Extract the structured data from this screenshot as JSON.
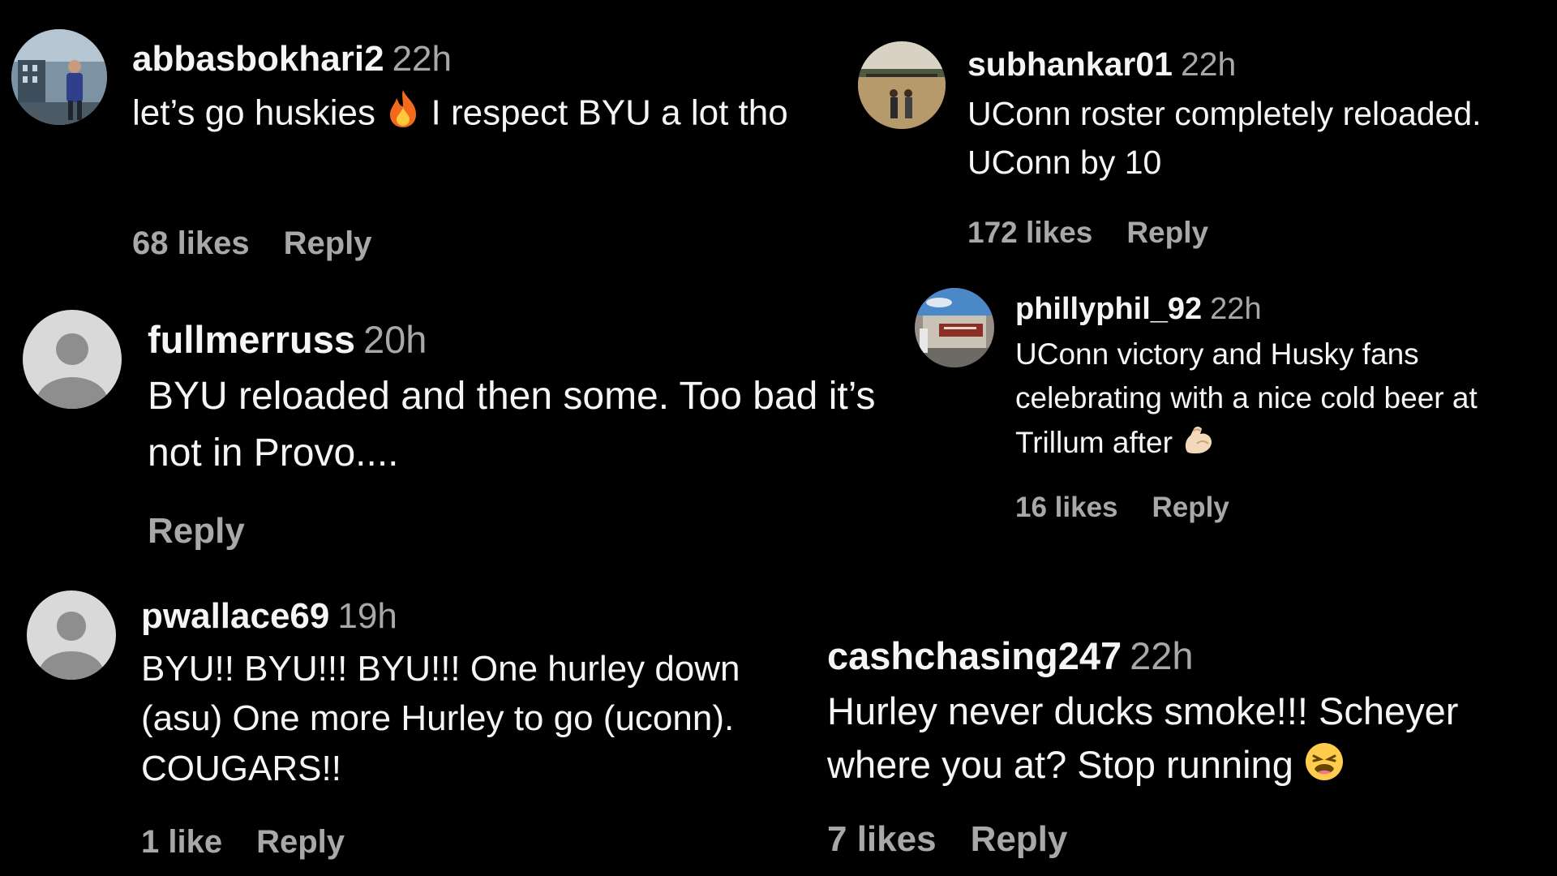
{
  "comments": [
    {
      "username": "abbasbokhari2",
      "time": "22h",
      "text_before": "let’s go huskies",
      "emoji_name": "fire-emoji",
      "text_after": "I respect BYU a lot tho",
      "likes": "68 likes",
      "reply": "Reply"
    },
    {
      "username": "subhankar01",
      "time": "22h",
      "text": "UConn roster completely reloaded. UConn by 10",
      "likes": "172 likes",
      "reply": "Reply"
    },
    {
      "username": "fullmerruss",
      "time": "20h",
      "text": "BYU reloaded and then some. Too bad it’s not in Provo....",
      "reply": "Reply"
    },
    {
      "username": "phillyphil_92",
      "time": "22h",
      "text": "UConn victory and Husky fans celebrating with a nice cold beer at Trillum after",
      "emoji_name": "flexed-biceps-emoji",
      "likes": "16 likes",
      "reply": "Reply"
    },
    {
      "username": "pwallace69",
      "time": "19h",
      "text": "BYU!! BYU!!! BYU!!! One hurley down (asu) One more Hurley to go (uconn). COUGARS!!",
      "likes": "1 like",
      "reply": "Reply"
    },
    {
      "username": "cashchasing247",
      "time": "22h",
      "text": "Hurley never ducks smoke!!! Scheyer where you at? Stop running",
      "emoji_name": "tired-face-emoji",
      "likes": "7 likes",
      "reply": "Reply"
    }
  ],
  "colors": {
    "background": "#000000",
    "primary_text": "#f5f5f5",
    "secondary_text": "#a8a8a8",
    "default_avatar_bg": "#d9d9d9",
    "default_avatar_fg": "#8e8e8e"
  }
}
